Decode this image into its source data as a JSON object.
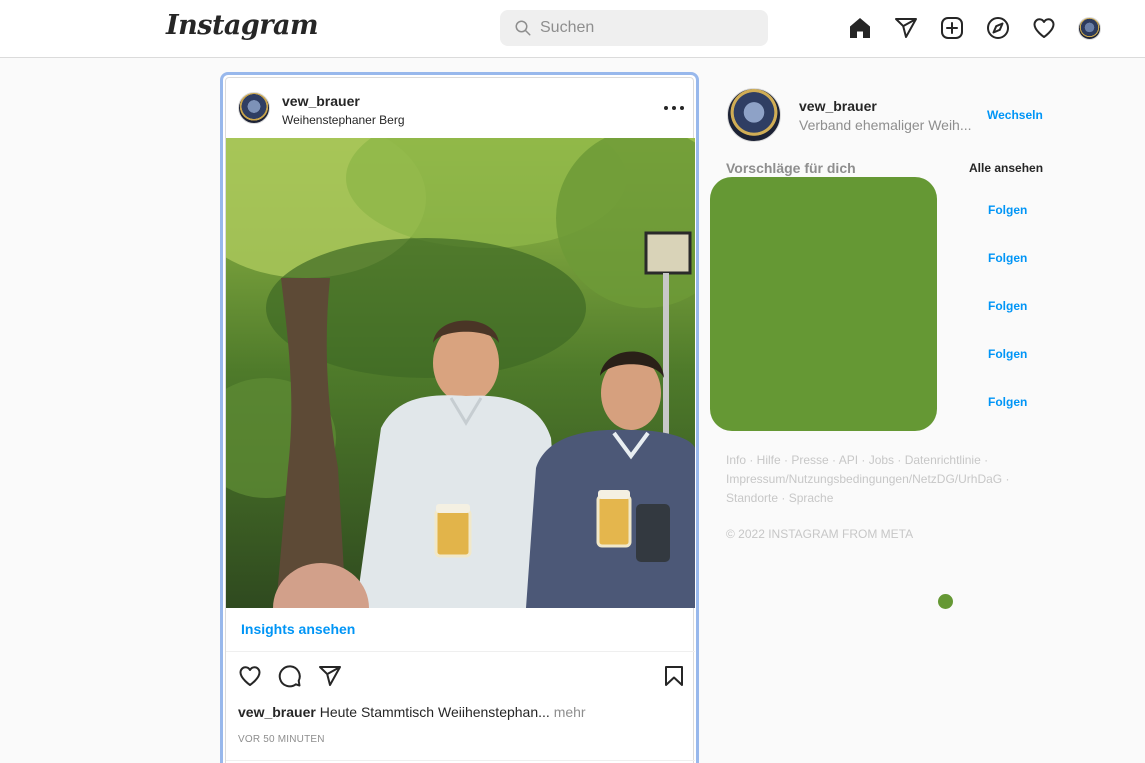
{
  "header": {
    "logo": "Instagram",
    "search_placeholder": "Suchen"
  },
  "post": {
    "username": "vew_brauer",
    "location": "Weihenstephaner Berg",
    "insights_label": "Insights ansehen",
    "caption_user": "vew_brauer",
    "caption_text": "Heute Stammtisch Weiihenstephan...",
    "caption_more": "mehr",
    "timestamp": "VOR 50 MINUTEN"
  },
  "sidebar": {
    "username": "vew_brauer",
    "full_name": "Verband ehemaliger Weih...",
    "switch_label": "Wechseln",
    "suggestions_title": "Vorschläge für dich",
    "see_all_label": "Alle ansehen",
    "follow_labels": [
      "Folgen",
      "Folgen",
      "Folgen",
      "Folgen",
      "Folgen"
    ],
    "footer_line1": "Info · Hilfe · Presse · API · Jobs · Datenrichtlinie ·",
    "footer_line2": "Impressum/Nutzungsbedingungen/NetzDG/UrhDaG ·",
    "footer_line3": "Standorte · Sprache",
    "copyright": "© 2022 INSTAGRAM FROM META"
  },
  "colors": {
    "accent": "#0095f6",
    "focus_ring": "#98b8ec",
    "redaction_green": "#659834"
  },
  "icons": [
    "search-icon",
    "home-icon",
    "direct-icon",
    "new-post-icon",
    "explore-icon",
    "activity-heart-icon",
    "like-heart-icon",
    "comment-icon",
    "share-icon",
    "save-bookmark-icon",
    "more-options-icon"
  ]
}
